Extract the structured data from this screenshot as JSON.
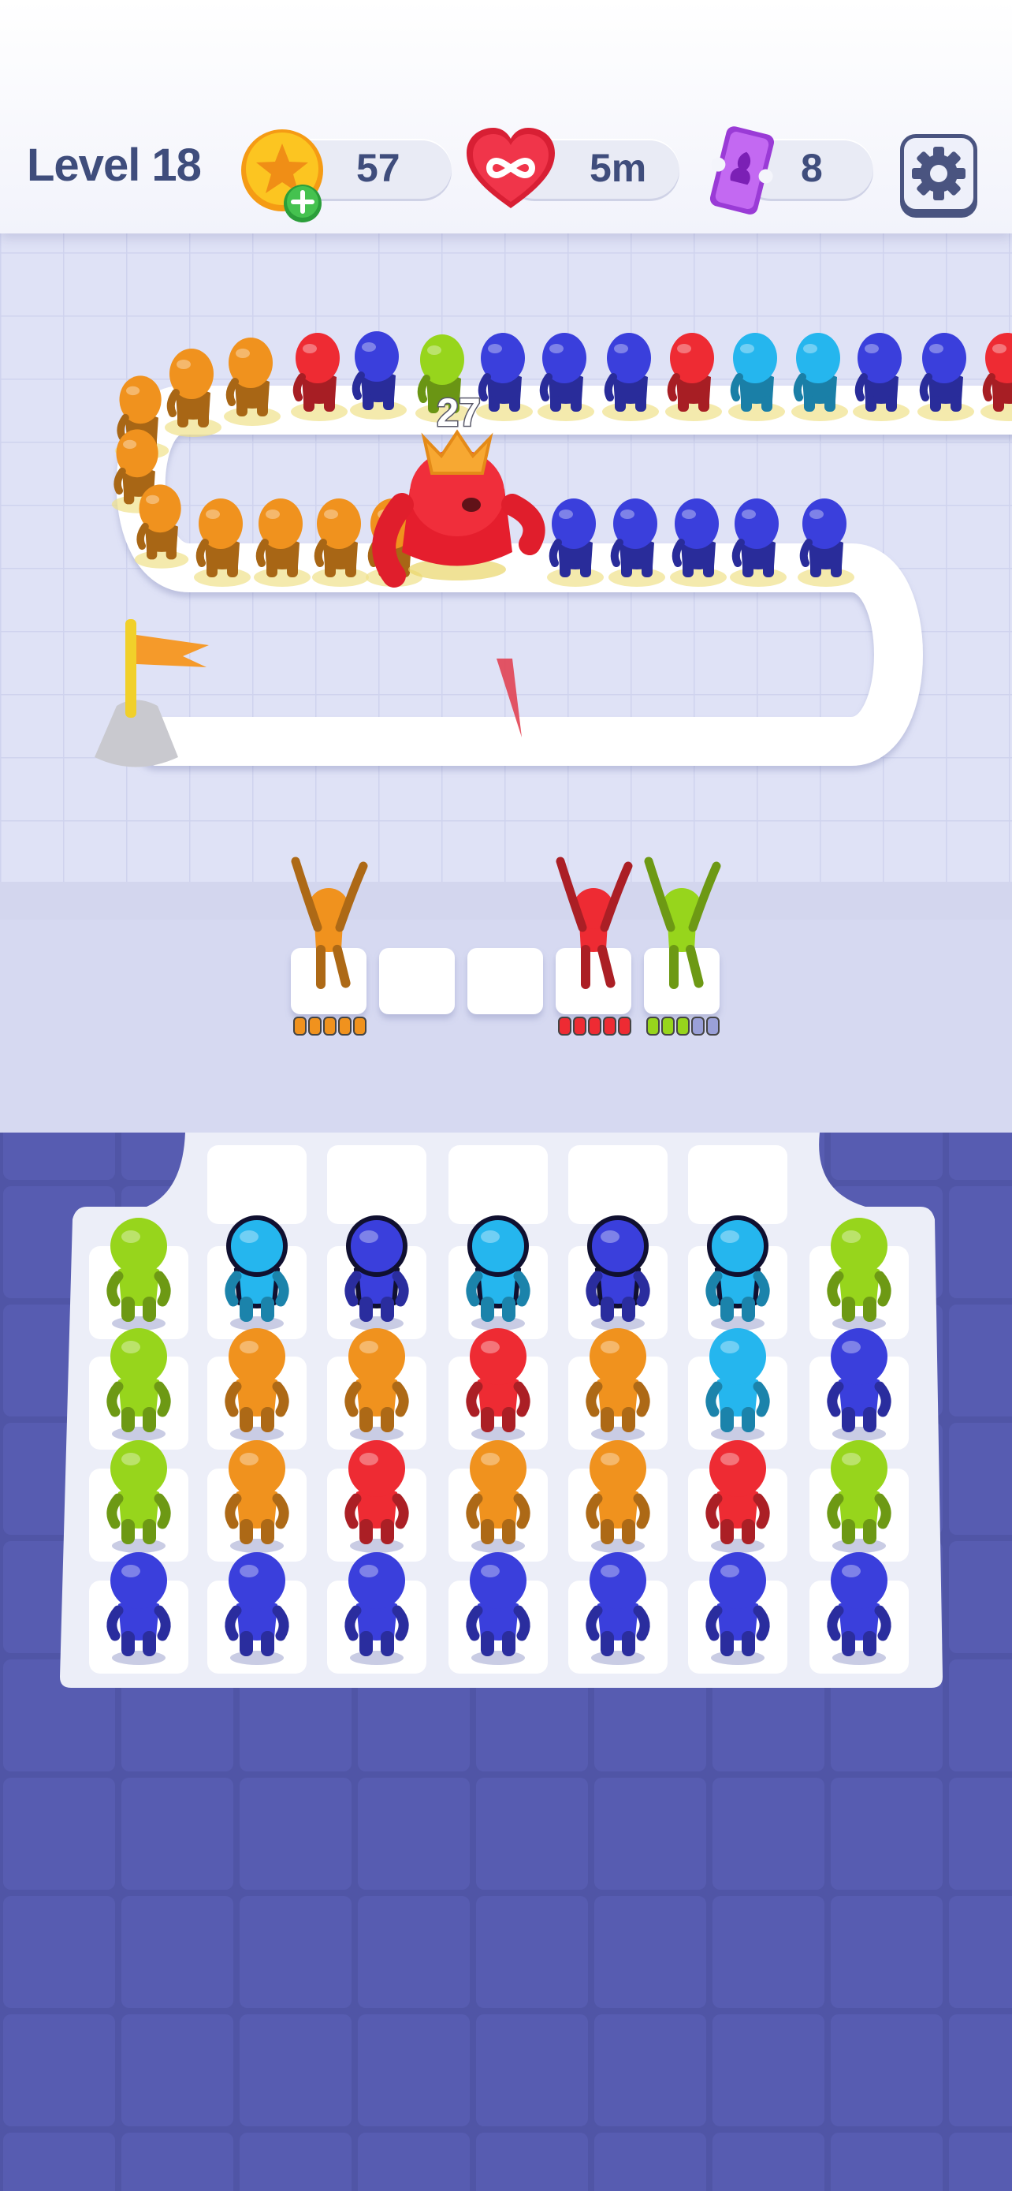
{
  "hud": {
    "level_label": "Level 18",
    "coins": "57",
    "lives": "5m",
    "tickets": "8",
    "icons": {
      "coin": "coin-plus-icon",
      "heart": "infinity-heart-icon",
      "ticket": "ticket-icon",
      "settings": "gear-icon"
    }
  },
  "track": {
    "boss_health": "27",
    "queue_top_row": [
      "orange",
      "orange",
      "red",
      "blue",
      "lime",
      "blue",
      "blue",
      "blue",
      "red",
      "cyan",
      "cyan",
      "blue",
      "blue",
      "red"
    ],
    "queue_bend": [
      "orange",
      "orange",
      "orange"
    ],
    "queue_second_row": [
      "orange",
      "orange",
      "orange",
      "orange",
      "blue",
      "blue",
      "blue",
      "blue",
      "blue"
    ]
  },
  "shooter_slots": [
    {
      "color": "orange",
      "ammo": [
        "orange",
        "orange",
        "orange",
        "orange",
        "orange"
      ],
      "ammo_used": 0
    },
    {
      "color": null,
      "ammo": []
    },
    {
      "color": null,
      "ammo": []
    },
    {
      "color": "red",
      "ammo": [
        "red",
        "red",
        "red",
        "red",
        "red"
      ],
      "ammo_used": 0
    },
    {
      "color": "lime",
      "ammo": [
        "lime",
        "lime",
        "lime",
        "lime",
        "lime"
      ],
      "ammo_used": 2
    }
  ],
  "grid": {
    "rows": [
      [
        "lime",
        "cyan",
        "blue",
        "cyan",
        "blue",
        "cyan",
        "lime"
      ],
      [
        "lime",
        "orange",
        "orange",
        "red",
        "orange",
        "cyan",
        "blue"
      ],
      [
        "lime",
        "orange",
        "red",
        "orange",
        "orange",
        "red",
        "lime"
      ],
      [
        "blue",
        "blue",
        "blue",
        "blue",
        "blue",
        "blue",
        "blue"
      ]
    ],
    "highlighted_row": 0
  },
  "palette": {
    "orange": "#f0921e",
    "red": "#ee2b33",
    "blue": "#3a3fdc",
    "lime": "#97d51c",
    "cyan": "#25b6ee"
  }
}
